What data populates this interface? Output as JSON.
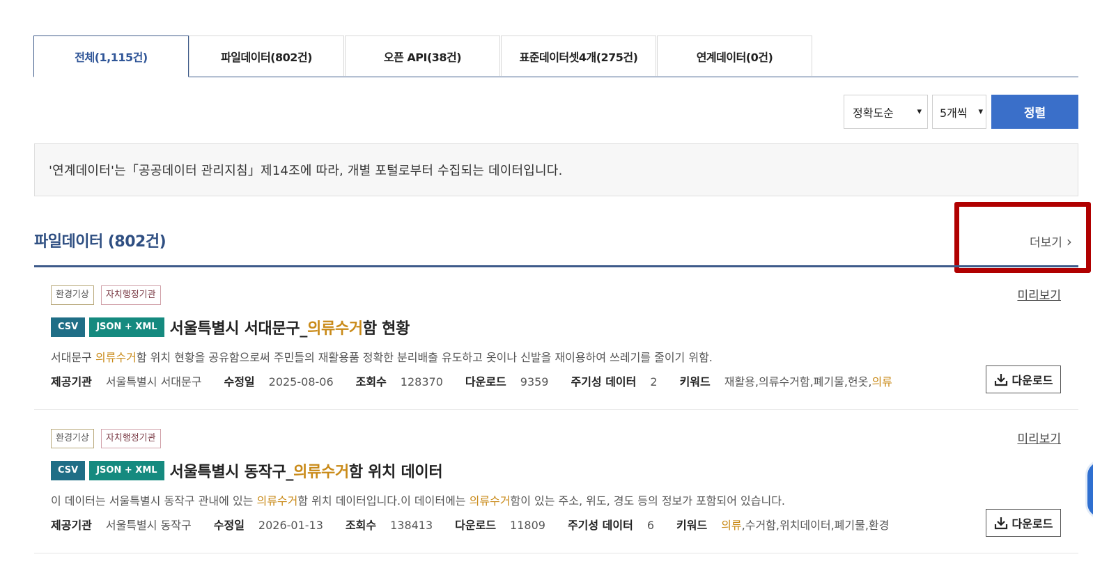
{
  "tabs": [
    {
      "label": "전체(1,115건)",
      "active": true
    },
    {
      "label": "파일데이터(802건)"
    },
    {
      "label": "오픈 API(38건)"
    },
    {
      "label": "표준데이터셋4개(275건)"
    },
    {
      "label": "연계데이터(0건)"
    }
  ],
  "sort": {
    "order_value": "정확도순",
    "count_value": "5개씩",
    "button_label": "정렬"
  },
  "notice": "'연계데이터'는「공공데이터 관리지침」제14조에 따라, 개별 포털로부터 수집되는 데이터입니다.",
  "section": {
    "title": "파일데이터 (802건)",
    "more_label": "더보기"
  },
  "items": [
    {
      "tags": [
        "환경기상",
        "자치행정기관"
      ],
      "preview_label": "미리보기",
      "formats": [
        "CSV",
        "JSON + XML"
      ],
      "title_pre": "서울특별시 서대문구_",
      "title_hl": "의류수거",
      "title_post": "함 현황",
      "desc_pre": "서대문구 ",
      "desc_hl": "의류수거",
      "desc_post": "함 위치 현황을 공유함으로써 주민들의 재활용품 정확한 분리배출 유도하고 옷이나 신발을 재이용하여 쓰레기를 줄이기 위함.",
      "meta": {
        "provider_label": "제공기관",
        "provider": "서울특별시 서대문구",
        "modified_label": "수정일",
        "modified": "2025-08-06",
        "views_label": "조회수",
        "views": "128370",
        "downloads_label": "다운로드",
        "downloads": "9359",
        "periodic_label": "주기성 데이터",
        "periodic": "2",
        "keyword_label": "키워드",
        "keywords_pre": "재활용,의류수거함,폐기물,헌옷,",
        "keywords_hl": "의류",
        "keywords_post": ""
      },
      "download_label": "다운로드"
    },
    {
      "tags": [
        "환경기상",
        "자치행정기관"
      ],
      "preview_label": "미리보기",
      "formats": [
        "CSV",
        "JSON + XML"
      ],
      "title_pre": "서울특별시 동작구_",
      "title_hl": "의류수거",
      "title_post": "함 위치 데이터",
      "desc_pre": "이 데이터는 서울특별시 동작구 관내에 있는 ",
      "desc_hl": "의류수거",
      "desc_mid": "함 위치 데이터입니다.이 데이터에는 ",
      "desc_hl2": "의류수거",
      "desc_post": "함이 있는 주소, 위도, 경도 등의 정보가 포함되어 있습니다.",
      "meta": {
        "provider_label": "제공기관",
        "provider": "서울특별시 동작구",
        "modified_label": "수정일",
        "modified": "2026-01-13",
        "views_label": "조회수",
        "views": "138413",
        "downloads_label": "다운로드",
        "downloads": "11809",
        "periodic_label": "주기성 데이터",
        "periodic": "6",
        "keyword_label": "키워드",
        "keywords_pre": "",
        "keywords_hl": "의류",
        "keywords_post": ",수거함,위치데이터,폐기물,환경"
      },
      "download_label": "다운로드"
    }
  ],
  "colors": {
    "accent_blue": "#3a6fc9",
    "nav_blue": "#2f4f82",
    "highlight": "#c98a18",
    "csv_badge": "#1f6e86",
    "json_badge": "#158a7f",
    "annotation_red": "#b00000"
  }
}
